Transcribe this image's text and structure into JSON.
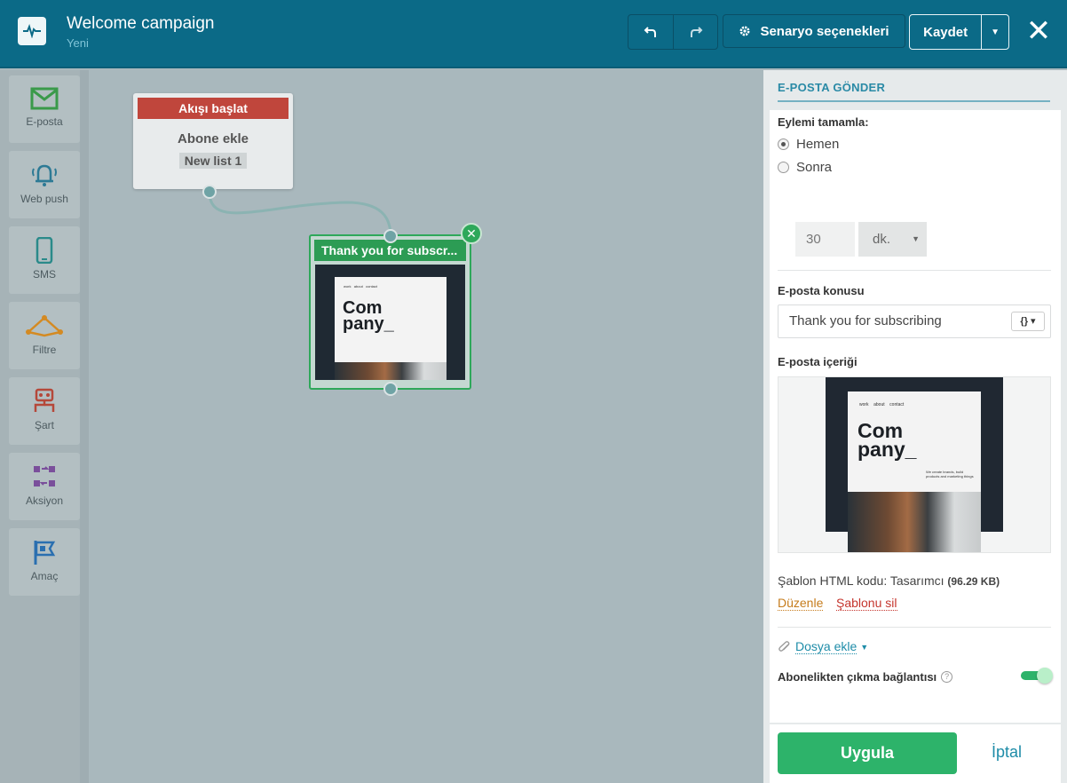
{
  "header": {
    "title": "Welcome campaign",
    "subtitle": "Yeni",
    "scenario_label": "Senaryo seçenekleri",
    "save_label": "Kaydet"
  },
  "palette": [
    {
      "label": "E-posta",
      "icon": "envelope-icon",
      "color": "#3a9a4a"
    },
    {
      "label": "Web push",
      "icon": "bell-icon",
      "color": "#2d7a95"
    },
    {
      "label": "SMS",
      "icon": "mobile-icon",
      "color": "#2a8a8a"
    },
    {
      "label": "Filtre",
      "icon": "filter-icon",
      "color": "#d48a22"
    },
    {
      "label": "Şart",
      "icon": "condition-icon",
      "color": "#b5483a"
    },
    {
      "label": "Aksiyon",
      "icon": "action-icon",
      "color": "#7a4f9b"
    },
    {
      "label": "Amaç",
      "icon": "flag-icon",
      "color": "#2a6fb0"
    }
  ],
  "canvas": {
    "start_node": {
      "header": "Akışı başlat",
      "title": "Abone ekle",
      "list": "New list 1"
    },
    "email_node": {
      "header": "Thank you for subscr...",
      "thumb_brand": "Com pany_"
    }
  },
  "panel": {
    "title": "E-POSTA GÖNDER",
    "complete_label": "Eylemi tamamla:",
    "option_now": "Hemen",
    "option_later": "Sonra",
    "delay_value": "30",
    "delay_unit": "dk.",
    "subject_label": "E-posta konusu",
    "subject_value": "Thank you for subscribing",
    "content_label": "E-posta içeriği",
    "template_info": "Şablon HTML kodu: Tasarımcı",
    "template_size": "(96.29 KB)",
    "edit_link": "Düzenle",
    "delete_link": "Şablonu sil",
    "attach_label": "Dosya ekle",
    "unsubscribe_label": "Abonelikten çıkma bağlantısı",
    "unsubscribe_enabled": true,
    "apply_label": "Uygula",
    "cancel_label": "İptal"
  },
  "template_preview": {
    "nav": [
      "work",
      "about",
      "contact"
    ],
    "brand_line1": "Com",
    "brand_line2": "pany_",
    "tagline": "We create brands, build products and marketing things"
  }
}
